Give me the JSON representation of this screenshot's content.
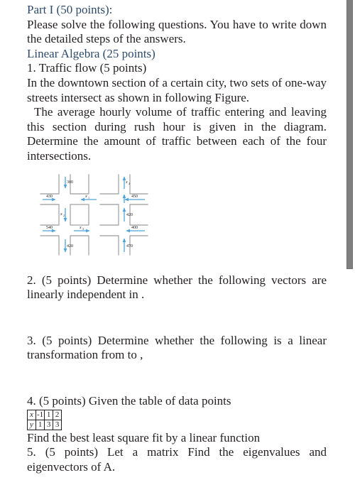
{
  "document": {
    "heading_color": "#2d4a6b",
    "body_color": "#231f20",
    "part_title": "Part I (50 points):",
    "instructions": "Please solve the following questions. You have to write down the detailed steps of the answers.",
    "section_title": "Linear Algebra (25 points)",
    "q1_title": "1. Traffic flow (5 points)",
    "q1_body_a": "In the downtown section of a certain city, two sets of one-way streets intersect as shown in following Figure.",
    "q1_body_b": "The average hourly volume of traffic entering and leaving this section during rush hour is given in the diagram. Determine the amount of traffic between each of the four intersections.",
    "q2_text": "2. (5 points) Determine whether the following vectors are linearly independent in .",
    "q3_text": "3. (5 points) Determine whether the following is a linear transformation from to ,",
    "q4_text": "4. (5 points) Given the table of data points",
    "q4_followup": "Find the best least square fit by a linear function",
    "q5_text": "5. (5 points) Let a matrix Find the eigenvalues and eigenvectors of A.",
    "data_table": {
      "rows": [
        {
          "header": "x",
          "values": [
            "-1",
            "1",
            "2"
          ]
        },
        {
          "header": "y",
          "values": [
            "1",
            "3",
            "3"
          ]
        }
      ]
    }
  },
  "diagram": {
    "name": "traffic-flow-diagram",
    "accent_color": "#4ea3d8",
    "street_color": "#8f8f8f",
    "label_color": "#231f20",
    "flows": [
      {
        "id": "top-left-in",
        "label": "380",
        "direction": "down",
        "kind": "known"
      },
      {
        "id": "left-top-in",
        "label": "430",
        "direction": "right",
        "kind": "known"
      },
      {
        "id": "x1",
        "label": "x₁",
        "direction": "left",
        "kind": "unknown"
      },
      {
        "id": "right-top-in",
        "label": "450",
        "direction": "left",
        "kind": "known"
      },
      {
        "id": "x4",
        "label": "x₄",
        "direction": "up",
        "kind": "unknown"
      },
      {
        "id": "x2",
        "label": "x₂",
        "direction": "down",
        "kind": "unknown"
      },
      {
        "id": "mid-right-in",
        "label": "420",
        "direction": "up",
        "kind": "known"
      },
      {
        "id": "left-bottom-in",
        "label": "540",
        "direction": "right",
        "kind": "known"
      },
      {
        "id": "x3",
        "label": "x₃",
        "direction": "right",
        "kind": "unknown"
      },
      {
        "id": "right-bottom-out",
        "label": "400",
        "direction": "left",
        "kind": "known"
      },
      {
        "id": "bottom-left-out",
        "label": "420",
        "direction": "down",
        "kind": "known"
      },
      {
        "id": "bottom-right-in",
        "label": "470",
        "direction": "up",
        "kind": "known"
      }
    ]
  },
  "scrollbar": {
    "name": "vertical-scrollbar",
    "thumb_color": "#808080"
  }
}
